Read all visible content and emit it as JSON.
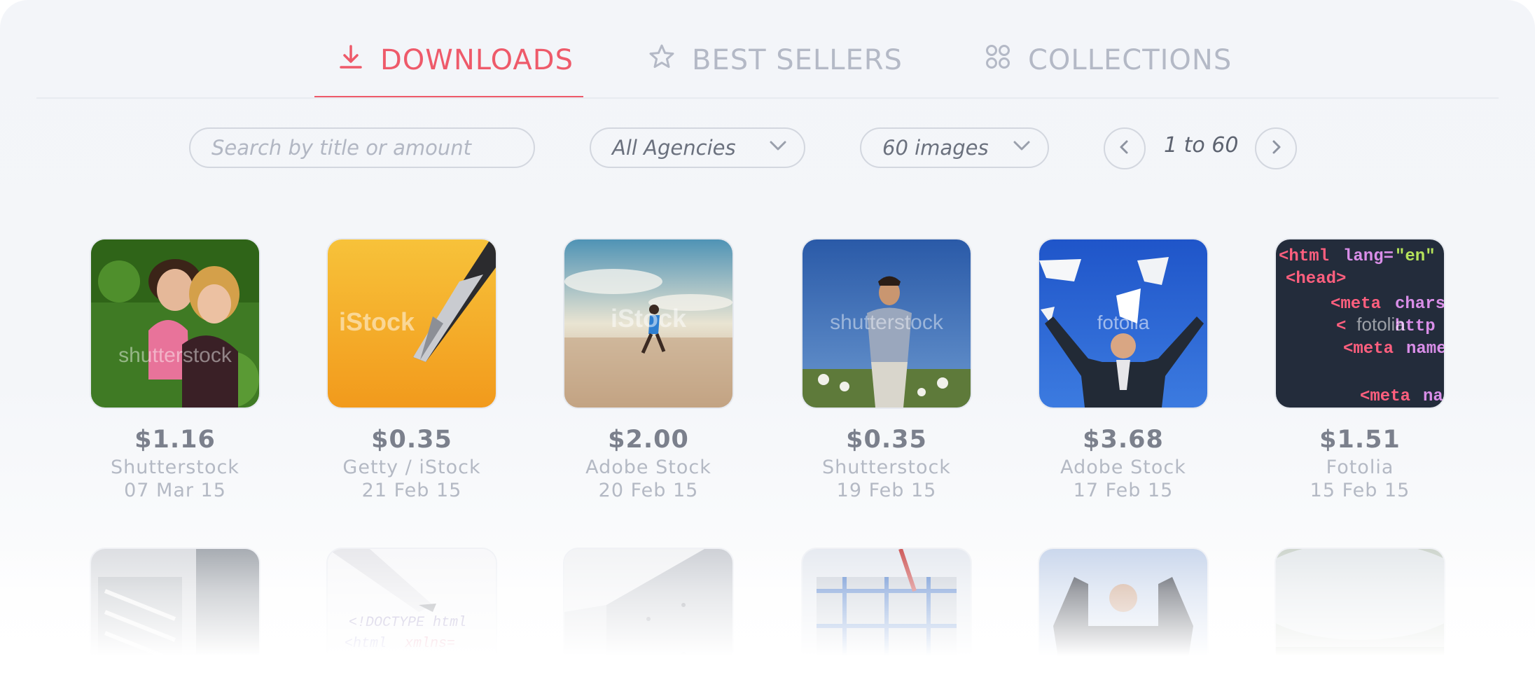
{
  "tabs": [
    {
      "label": "DOWNLOADS",
      "icon": "download-icon",
      "active": true
    },
    {
      "label": "BEST SELLERS",
      "icon": "star-icon",
      "active": false
    },
    {
      "label": "COLLECTIONS",
      "icon": "grid-icon",
      "active": false
    }
  ],
  "toolbar": {
    "search_placeholder": "Search by title or amount",
    "agency_select": "All Agencies",
    "count_select": "60 images",
    "range_label": "1 to 60"
  },
  "colors": {
    "accent": "#ee5a6a",
    "muted": "#b4b9c6",
    "text": "#7b808c"
  },
  "images": [
    {
      "price": "$1.16",
      "agency": "Shutterstock",
      "date": "07 Mar 15",
      "subject": "two girls on grass",
      "watermark": "shutterstock"
    },
    {
      "price": "$0.35",
      "agency": "Getty / iStock",
      "date": "21 Feb 15",
      "subject": "fountain pen nib",
      "watermark": "iStock"
    },
    {
      "price": "$2.00",
      "agency": "Adobe Stock",
      "date": "20 Feb 15",
      "subject": "runner on beach",
      "watermark": "iStock"
    },
    {
      "price": "$0.35",
      "agency": "Shutterstock",
      "date": "19 Feb 15",
      "subject": "man in field",
      "watermark": "shutterstock"
    },
    {
      "price": "$3.68",
      "agency": "Adobe Stock",
      "date": "17 Feb 15",
      "subject": "businessman throwing papers",
      "watermark": "fotolia"
    },
    {
      "price": "$1.51",
      "agency": "Fotolia",
      "date": "15 Feb 15",
      "subject": "html code",
      "watermark": "fotolia"
    }
  ],
  "images_row2": [
    {
      "subject": "server hardware"
    },
    {
      "subject": "pen on html code"
    },
    {
      "subject": "server rack"
    },
    {
      "subject": "construction"
    },
    {
      "subject": "businessman celebrating"
    },
    {
      "subject": "blurred landscape"
    }
  ]
}
